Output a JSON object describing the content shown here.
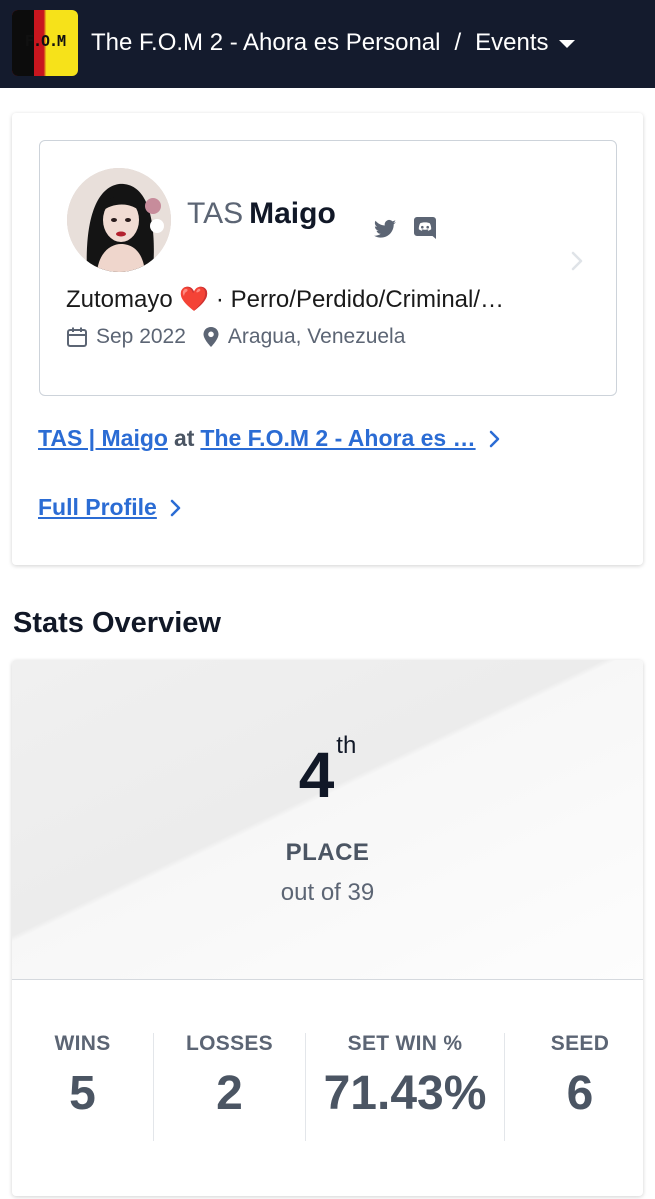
{
  "header": {
    "logo_text": "F.O.M",
    "tournament_name": "The F.O.M 2 - Ahora es Personal",
    "separator": "/",
    "section": "Events"
  },
  "profile": {
    "prefix": "TAS",
    "gamertag": "Maigo",
    "bio": "Zutomayo ❤️ · Perro/Perdido/Criminal/…",
    "joined": "Sep 2022",
    "location": "Aragua, Venezuela",
    "icons": [
      "twitter-icon",
      "discord-icon",
      "calendar-icon",
      "location-pin-icon"
    ]
  },
  "links": {
    "entrant_name": "TAS | Maigo",
    "entrant_at": "at",
    "entrant_event": "The F.O.M 2 - Ahora es …",
    "full_profile": "Full Profile"
  },
  "stats": {
    "title": "Stats Overview",
    "place": "4",
    "place_suffix": "th",
    "place_label": "PLACE",
    "out_of": "out of 39",
    "items": [
      {
        "label": "WINS",
        "value": "5"
      },
      {
        "label": "LOSSES",
        "value": "2"
      },
      {
        "label": "SET WIN %",
        "value": "71.43%"
      },
      {
        "label": "SEED",
        "value": "6"
      }
    ]
  },
  "colors": {
    "header_bg": "#141b2d",
    "link": "#2b6cd4",
    "heart": "#e0202a"
  }
}
